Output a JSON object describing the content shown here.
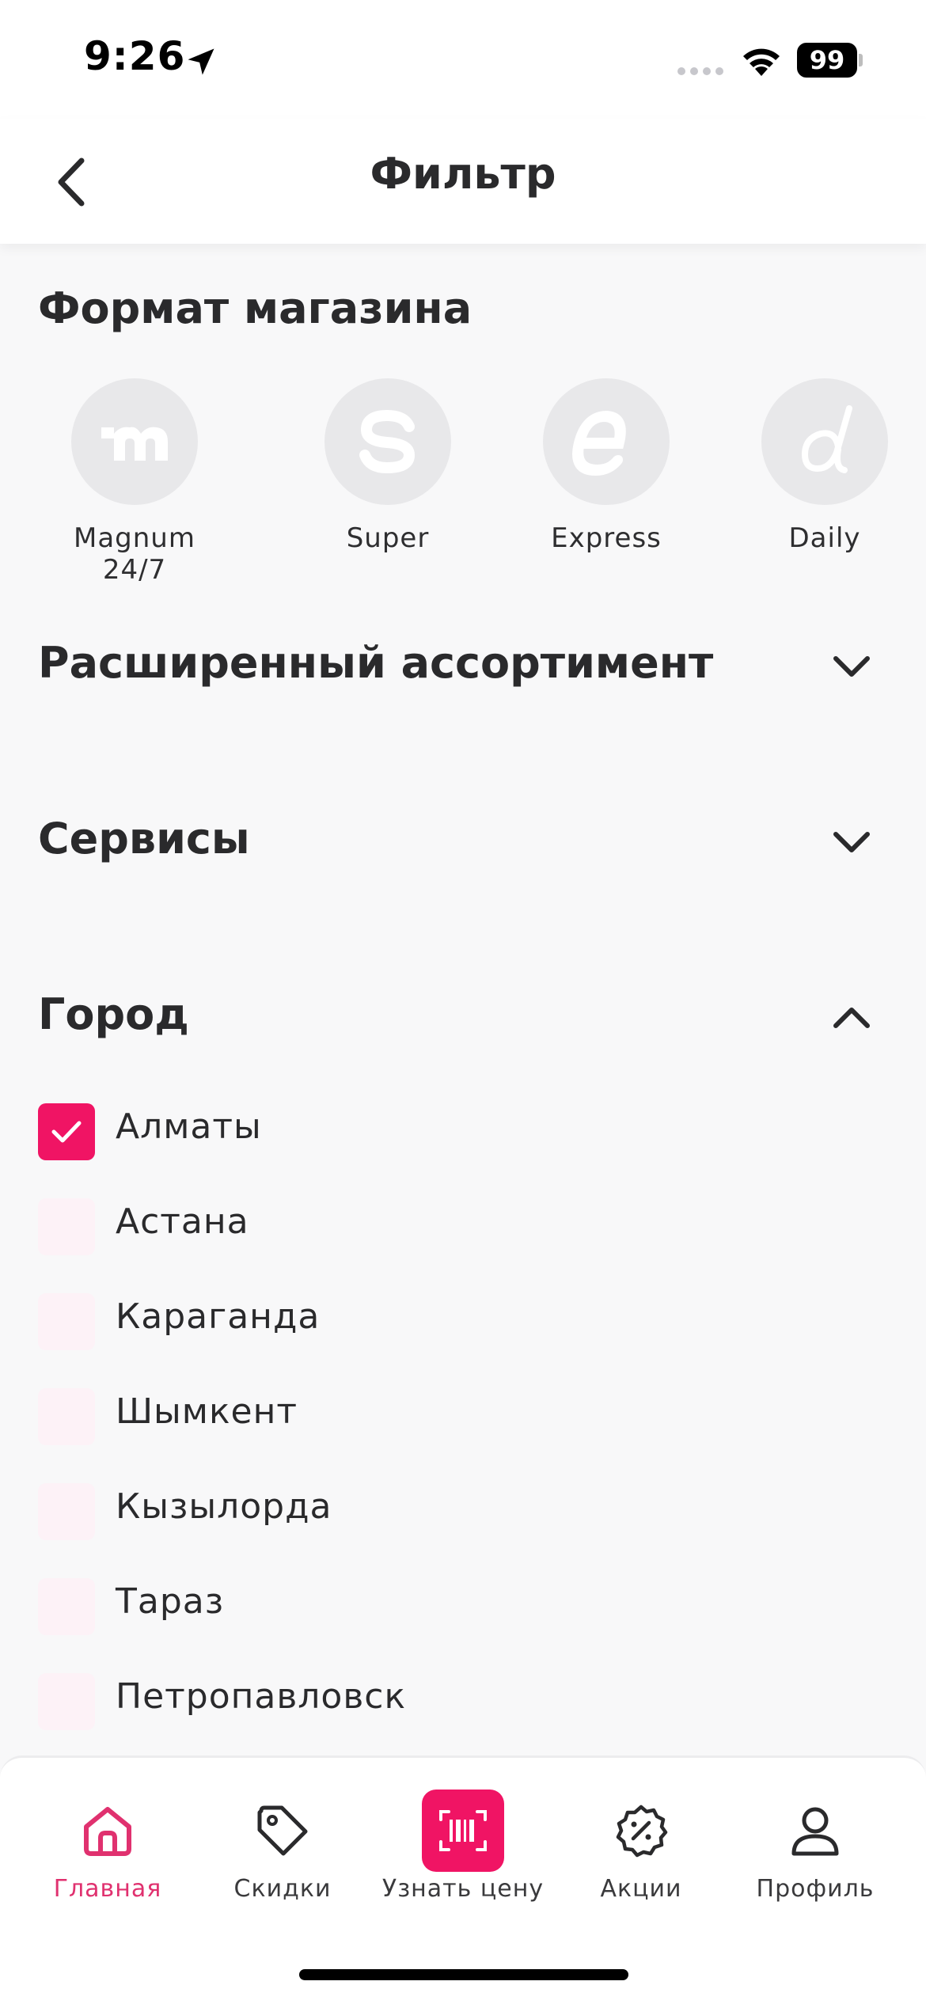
{
  "status_bar": {
    "time": "9:26",
    "battery": "99"
  },
  "header": {
    "title": "Фильтр"
  },
  "store_format": {
    "title": "Формат магазина",
    "formats": [
      {
        "label": "Magnum 24/7",
        "icon": "magnum-logo-icon"
      },
      {
        "label": "Super",
        "icon": "super-logo-icon"
      },
      {
        "label": "Express",
        "icon": "express-logo-icon"
      },
      {
        "label": "Daily",
        "icon": "daily-logo-icon"
      }
    ]
  },
  "extended_assortment": {
    "title": "Расширенный ассортимент",
    "expanded": false
  },
  "services": {
    "title": "Сервисы",
    "expanded": false
  },
  "city": {
    "title": "Город",
    "expanded": true,
    "items": [
      {
        "label": "Алматы",
        "checked": true
      },
      {
        "label": "Астана",
        "checked": false
      },
      {
        "label": "Караганда",
        "checked": false
      },
      {
        "label": "Шымкент",
        "checked": false
      },
      {
        "label": "Кызылорда",
        "checked": false
      },
      {
        "label": "Тараз",
        "checked": false
      },
      {
        "label": "Петропавловск",
        "checked": false
      }
    ]
  },
  "tab_bar": {
    "active": "Главная",
    "tabs": [
      {
        "label": "Главная",
        "icon": "home-icon"
      },
      {
        "label": "Скидки",
        "icon": "tag-icon"
      },
      {
        "label": "Узнать цену",
        "icon": "barcode-scan-icon"
      },
      {
        "label": "Акции",
        "icon": "percent-badge-icon"
      },
      {
        "label": "Профиль",
        "icon": "profile-icon"
      }
    ]
  },
  "colors": {
    "accent": "#f01464",
    "active_tab": "#e0316f",
    "background": "#f8f8f9"
  }
}
